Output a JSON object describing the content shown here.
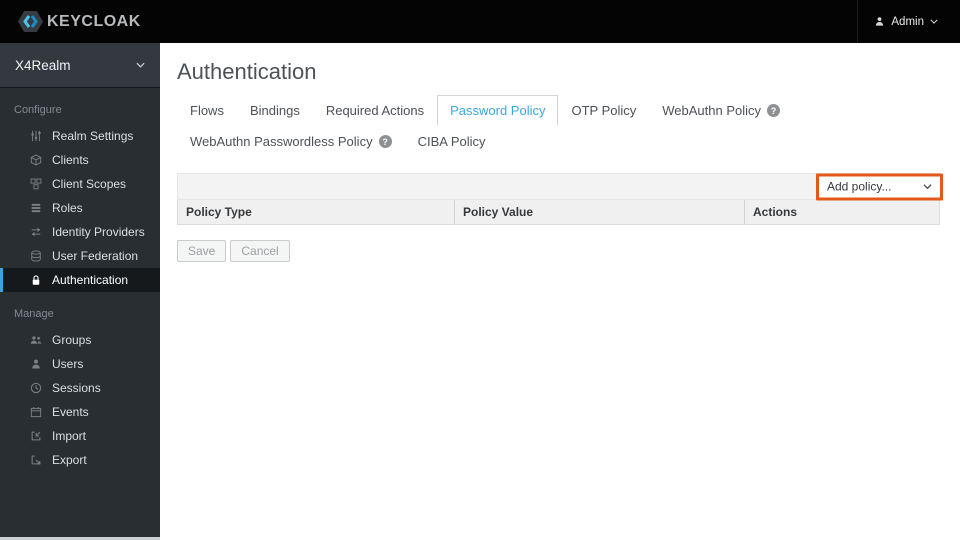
{
  "topbar": {
    "brand": "KEYCLOAK",
    "user": {
      "label": "Admin"
    }
  },
  "sidebar": {
    "realm_label": "X4Realm",
    "sections": [
      {
        "label": "Configure",
        "items": [
          {
            "label": "Realm Settings",
            "icon": "sliders-icon"
          },
          {
            "label": "Clients",
            "icon": "cube-icon"
          },
          {
            "label": "Client Scopes",
            "icon": "cubes-icon"
          },
          {
            "label": "Roles",
            "icon": "list-bars-icon"
          },
          {
            "label": "Identity Providers",
            "icon": "exchange-arrows-icon"
          },
          {
            "label": "User Federation",
            "icon": "database-icon"
          },
          {
            "label": "Authentication",
            "icon": "lock-icon",
            "active": true
          }
        ]
      },
      {
        "label": "Manage",
        "items": [
          {
            "label": "Groups",
            "icon": "group-icon"
          },
          {
            "label": "Users",
            "icon": "user-icon"
          },
          {
            "label": "Sessions",
            "icon": "clock-icon"
          },
          {
            "label": "Events",
            "icon": "calendar-icon"
          },
          {
            "label": "Import",
            "icon": "import-icon"
          },
          {
            "label": "Export",
            "icon": "export-icon"
          }
        ]
      }
    ]
  },
  "main": {
    "title": "Authentication",
    "help_glyph": "?",
    "tabs": [
      {
        "label": "Flows"
      },
      {
        "label": "Bindings"
      },
      {
        "label": "Required Actions"
      },
      {
        "label": "Password Policy",
        "active": true
      },
      {
        "label": "OTP Policy"
      },
      {
        "label": "WebAuthn Policy",
        "help": true
      },
      {
        "label": "WebAuthn Passwordless Policy",
        "help": true
      },
      {
        "label": "CIBA Policy"
      }
    ],
    "toolbar": {
      "add_policy": "Add policy..."
    },
    "table": {
      "columns": [
        "Policy Type",
        "Policy Value",
        "Actions"
      ],
      "rows": []
    },
    "actions": {
      "save": "Save",
      "cancel": "Cancel"
    }
  },
  "colors": {
    "topbar_bg": "#040404",
    "sidebar_bg": "#292e33",
    "accent_blue": "#39a5dc",
    "highlight_orange": "#e4591b"
  }
}
